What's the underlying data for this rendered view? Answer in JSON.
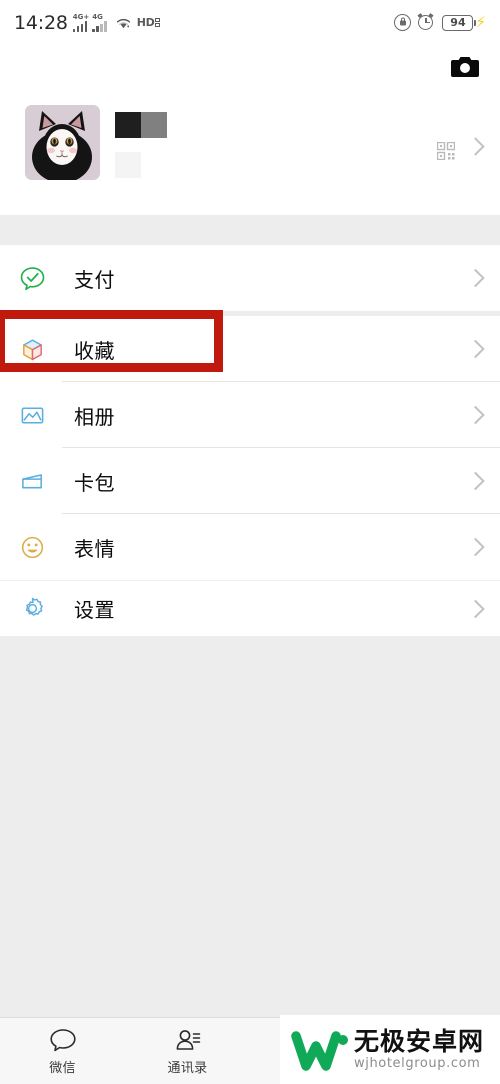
{
  "status_bar": {
    "time": "14:28",
    "network_label_1": "4G+",
    "network_label_2": "4G",
    "wifi_icon": "wifi-icon",
    "hd_label": "HD",
    "lock_icon": "rotation-lock-icon",
    "alarm_icon": "alarm-clock-icon",
    "battery_percent": "94",
    "charging_icon": "charging-bolt-icon"
  },
  "header": {
    "camera_icon": "camera-icon"
  },
  "profile": {
    "avatar_icon": "cat-avatar",
    "name_redacted": "",
    "wechat_id_redacted": "",
    "qr_icon": "qr-code-icon",
    "chevron_icon": "chevron-right-icon"
  },
  "menu": {
    "items": [
      {
        "label": "支付",
        "icon": "pay-icon",
        "name": "menu-item-pay"
      },
      {
        "label": "收藏",
        "icon": "favorites-icon",
        "name": "menu-item-favorites"
      },
      {
        "label": "相册",
        "icon": "album-icon",
        "name": "menu-item-album"
      },
      {
        "label": "卡包",
        "icon": "cards-icon",
        "name": "menu-item-cards"
      },
      {
        "label": "表情",
        "icon": "sticker-icon",
        "name": "menu-item-stickers"
      },
      {
        "label": "设置",
        "icon": "settings-icon",
        "name": "menu-item-settings"
      }
    ]
  },
  "highlight": {
    "target": "收藏",
    "color": "#c01a0f"
  },
  "tabbar": {
    "items": [
      {
        "label": "微信",
        "icon": "chat-bubble-icon"
      },
      {
        "label": "通讯录",
        "icon": "contacts-icon"
      },
      {
        "label": "",
        "icon": "discover-icon"
      },
      {
        "label": "",
        "icon": "me-icon"
      }
    ]
  },
  "watermark": {
    "cn_text": "无极安卓网",
    "en_text": "wjhotelgroup.com",
    "logo_icon": "w-logo-icon",
    "logo_color": "#0fa958"
  },
  "colors": {
    "page_bg": "#ededed",
    "card_bg": "#ffffff",
    "text": "#0d0d0d",
    "chevron": "#c2c2c2",
    "pay_green": "#1aad19",
    "icon_blue": "#4c9fd4",
    "icon_orange": "#e8a33d",
    "highlight_red": "#c01a0f"
  }
}
